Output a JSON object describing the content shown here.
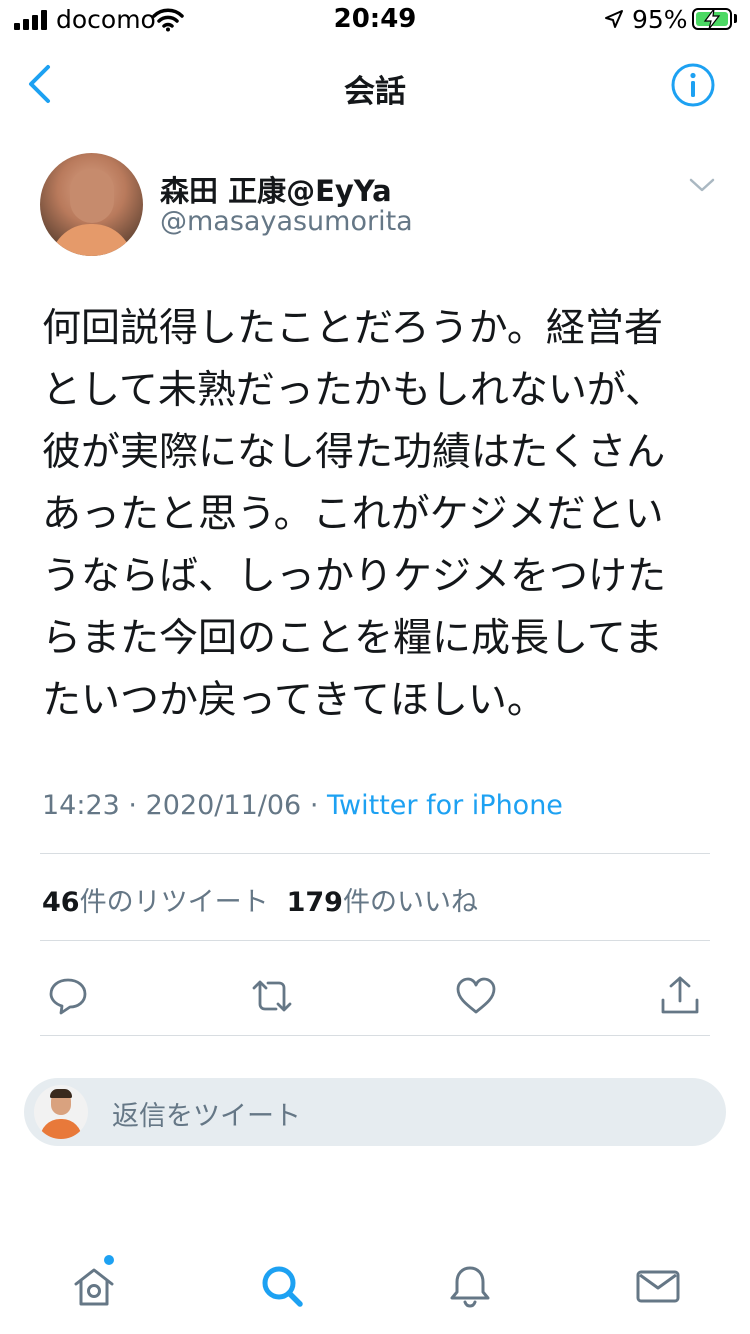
{
  "status_bar": {
    "carrier": "docomo",
    "time": "20:49",
    "battery_percent": "95%"
  },
  "nav": {
    "title": "会話"
  },
  "tweet": {
    "author_name": "森田 正康@EyYa",
    "author_handle": "@masayasumorita",
    "text_lines": [
      "何回説得したことだろうか。経営者",
      "として未熟だったかもしれないが、",
      "彼が実際になし得た功績はたくさん",
      "あったと思う。これがケジメだとい",
      "うならば、しっかりケジメをつけた",
      "らまた今回のことを糧に成長してま",
      "たいつか戻ってきてほしい。"
    ],
    "time": "14:23",
    "separator": "·",
    "date": "2020/11/06",
    "source": "Twitter for iPhone",
    "retweet_count": "46",
    "retweet_label": "件のリツイート",
    "like_count": "179",
    "like_label": "件のいいね"
  },
  "actions": [
    "reply-icon",
    "retweet-icon",
    "like-icon",
    "share-icon"
  ],
  "reply_box": {
    "placeholder": "返信をツイート"
  },
  "tab_bar": {
    "items": [
      "home-icon",
      "search-icon",
      "notifications-icon",
      "messages-icon"
    ],
    "active": "search-icon",
    "home_has_new": true
  },
  "colors": {
    "accent": "#1da1f2",
    "secondary_text": "#657786",
    "primary_text": "#14171a",
    "divider": "#d8dde1",
    "reply_bg": "#e6ecf0"
  }
}
